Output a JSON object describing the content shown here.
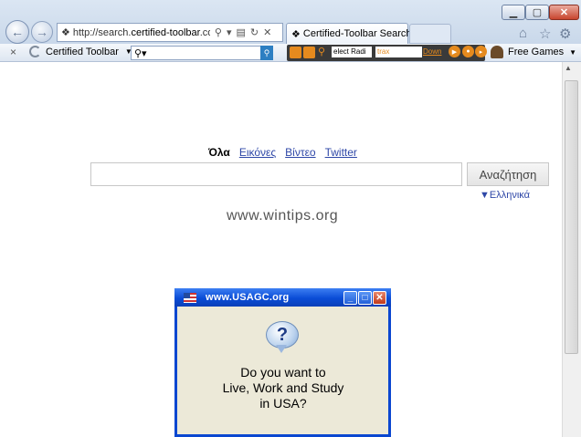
{
  "browser": {
    "address_host_prefix": "http://search.",
    "address_host": "certified-toolbar",
    "address_suffix": ".com/?si",
    "tab_title": "Certified-Toolbar Search",
    "tab_close": "×"
  },
  "toolbar": {
    "close": "×",
    "brand": "Certified Toolbar",
    "search_icon": "magnifier-icon",
    "radio_station": "elect Radi",
    "radio_trax": "trax",
    "radio_down": "Down",
    "games": "Free Games"
  },
  "page": {
    "tabs": [
      "Όλα",
      "Εικόνες",
      "Βίντεο",
      "Twitter"
    ],
    "search_button": "Αναζήτηση",
    "language": "▼Ελληνικά",
    "watermark": "www.wintips.org"
  },
  "popup": {
    "title": "www.USAGC.org",
    "message_lines": [
      "Do you want to",
      "Live, Work and Study",
      "in USA?"
    ]
  },
  "colors": {
    "title_bar": "#0a4cd6",
    "radio_accent": "#e58a1e",
    "link": "#2e47a7"
  }
}
